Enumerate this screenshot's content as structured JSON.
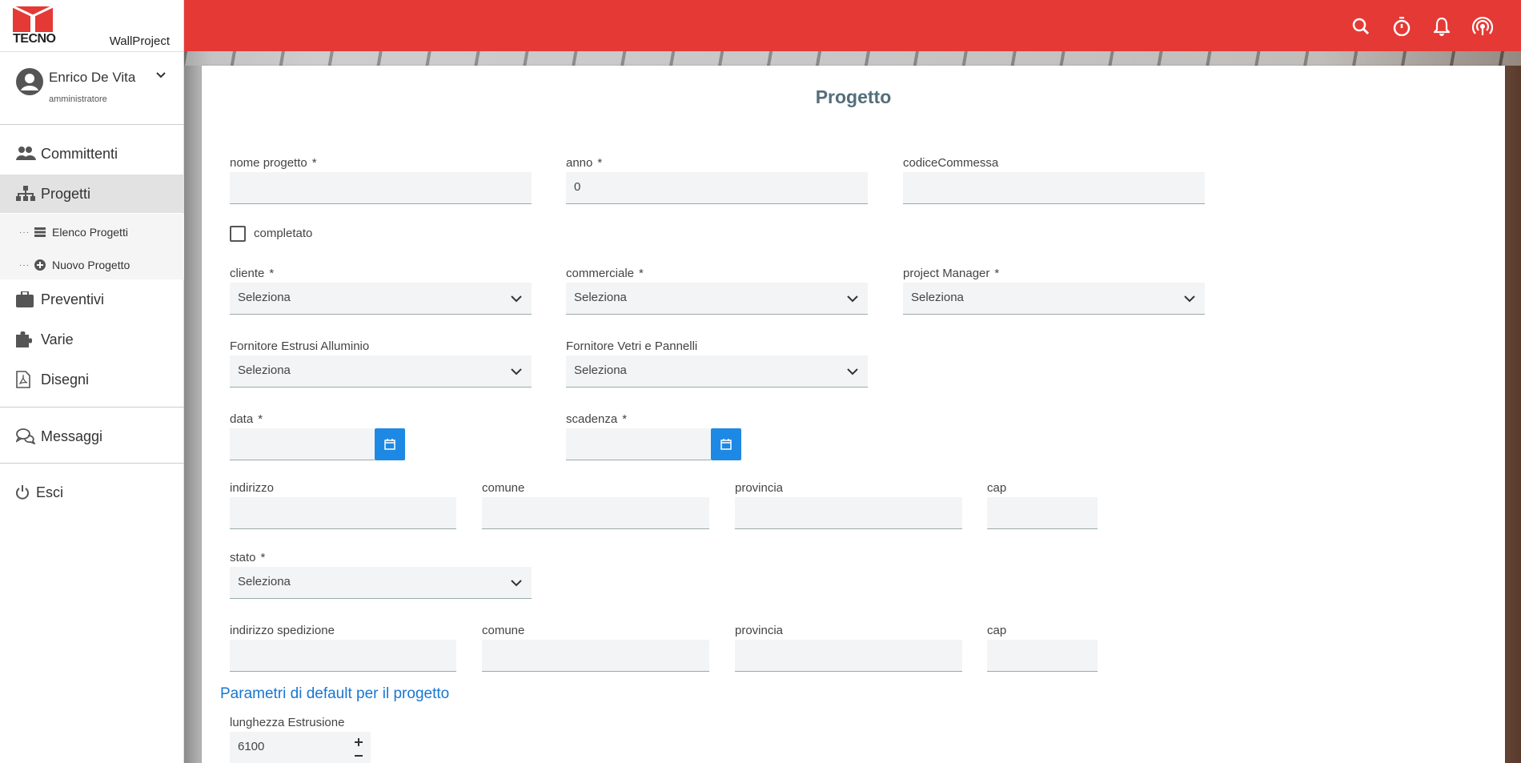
{
  "brand": {
    "logo_word": "TECNO",
    "app_name": "WallProject",
    "accent": "#e53935",
    "primary": "#1e88e5"
  },
  "user": {
    "name": "Enrico De Vita",
    "role": "amministratore"
  },
  "nav": {
    "committenti": "Committenti",
    "progetti": "Progetti",
    "elenco_progetti": "Elenco Progetti",
    "nuovo_progetto": "Nuovo Progetto",
    "preventivi": "Preventivi",
    "varie": "Varie",
    "disegni": "Disegni",
    "messaggi": "Messaggi",
    "esci": "Esci"
  },
  "topbar_icons": [
    "search-icon",
    "timer-icon",
    "bell-icon",
    "broadcast-icon"
  ],
  "form": {
    "title": "Progetto",
    "required_mark": "*",
    "select_placeholder": "Seleziona",
    "nome_progetto": {
      "label": "nome progetto",
      "value": ""
    },
    "anno": {
      "label": "anno",
      "value": "0"
    },
    "codice_commessa": {
      "label": "codiceCommessa",
      "value": ""
    },
    "completato": {
      "label": "completato",
      "checked": false
    },
    "cliente": {
      "label": "cliente",
      "value": "Seleziona"
    },
    "commerciale": {
      "label": "commerciale",
      "value": "Seleziona"
    },
    "project_manager": {
      "label": "project Manager",
      "value": "Seleziona"
    },
    "fornitore_estrusi": {
      "label": "Fornitore Estrusi Alluminio",
      "value": "Seleziona"
    },
    "fornitore_vetri": {
      "label": "Fornitore Vetri e Pannelli",
      "value": "Seleziona"
    },
    "data": {
      "label": "data",
      "value": ""
    },
    "scadenza": {
      "label": "scadenza",
      "value": ""
    },
    "indirizzo": {
      "label": "indirizzo",
      "value": ""
    },
    "comune": {
      "label": "comune",
      "value": ""
    },
    "provincia": {
      "label": "provincia",
      "value": ""
    },
    "cap": {
      "label": "cap",
      "value": ""
    },
    "stato": {
      "label": "stato",
      "value": "Seleziona"
    },
    "indirizzo_spedizione": {
      "label": "indirizzo spedizione",
      "value": ""
    },
    "comune_sped": {
      "label": "comune",
      "value": ""
    },
    "provincia_sped": {
      "label": "provincia",
      "value": ""
    },
    "cap_sped": {
      "label": "cap",
      "value": ""
    },
    "defaults_title": "Parametri di default per il progetto",
    "lunghezza_estrusione": {
      "label": "lunghezza Estrusione",
      "value": "6100"
    }
  }
}
